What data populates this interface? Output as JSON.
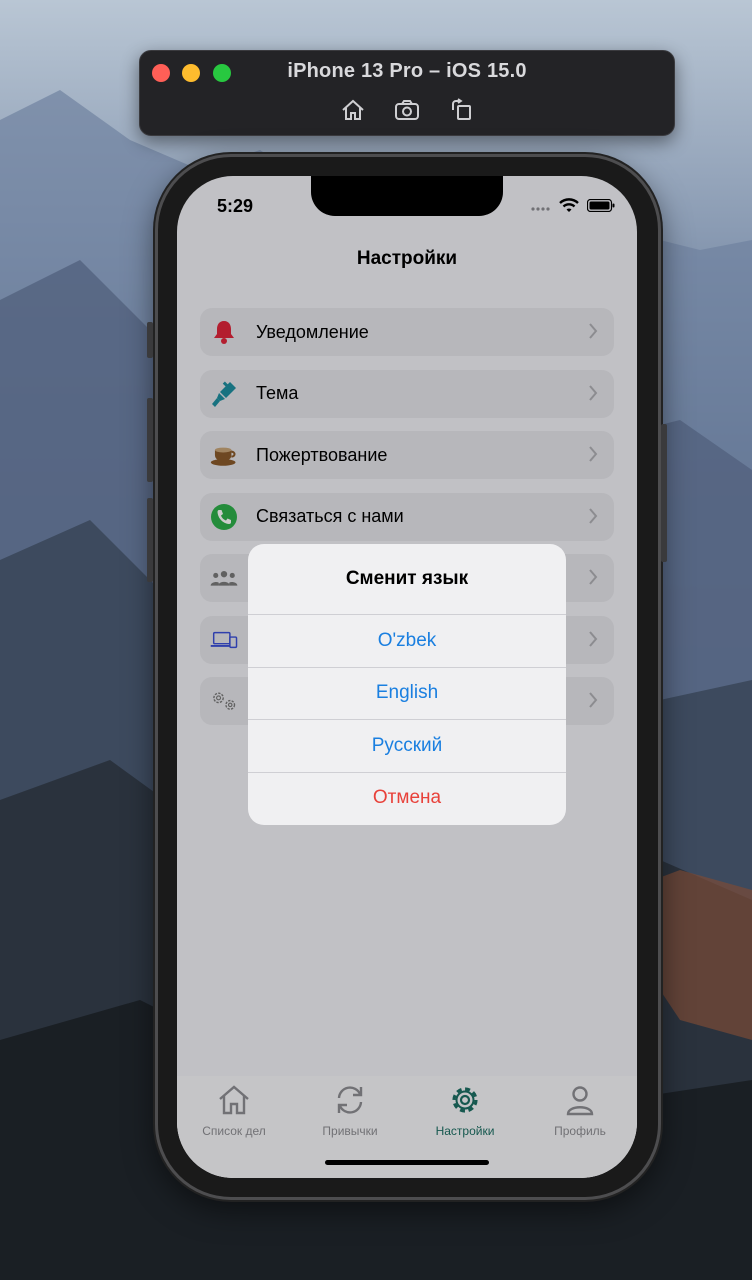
{
  "simulator": {
    "title": "iPhone 13 Pro – iOS 15.0",
    "tools": [
      "home-icon",
      "screenshot-icon",
      "rotate-icon"
    ]
  },
  "status_bar": {
    "time": "5:29"
  },
  "nav": {
    "title": "Настройки"
  },
  "settings": {
    "items": [
      {
        "label": "Уведомление",
        "icon": "bell-icon",
        "color": "#e0263b"
      },
      {
        "label": "Тема",
        "icon": "paintbrush-icon",
        "color": "#1f8fa0"
      },
      {
        "label": "Пожертвование",
        "icon": "coffee-cup-icon",
        "color": "#8a5a2b"
      },
      {
        "label": "Связаться с нами",
        "icon": "phone-icon",
        "color": "#2db04a"
      },
      {
        "label": "",
        "icon": "users-icon",
        "color": "#7a7a7a"
      },
      {
        "label": "",
        "icon": "devices-icon",
        "color": "#3b4fd8"
      },
      {
        "label": "",
        "icon": "gears-icon",
        "color": "#7a7a7a"
      }
    ]
  },
  "alert": {
    "title": "Сменит язык",
    "options": [
      "O'zbek",
      "English",
      "Русский"
    ],
    "cancel": "Отмена"
  },
  "tabbar": {
    "tabs": [
      {
        "label": "Список дел",
        "icon": "house-icon",
        "active": false
      },
      {
        "label": "Привычки",
        "icon": "refresh-icon",
        "active": false
      },
      {
        "label": "Настройки",
        "icon": "gear-icon",
        "active": true
      },
      {
        "label": "Профиль",
        "icon": "person-icon",
        "active": false
      }
    ],
    "active_color": "#1c6f63"
  }
}
